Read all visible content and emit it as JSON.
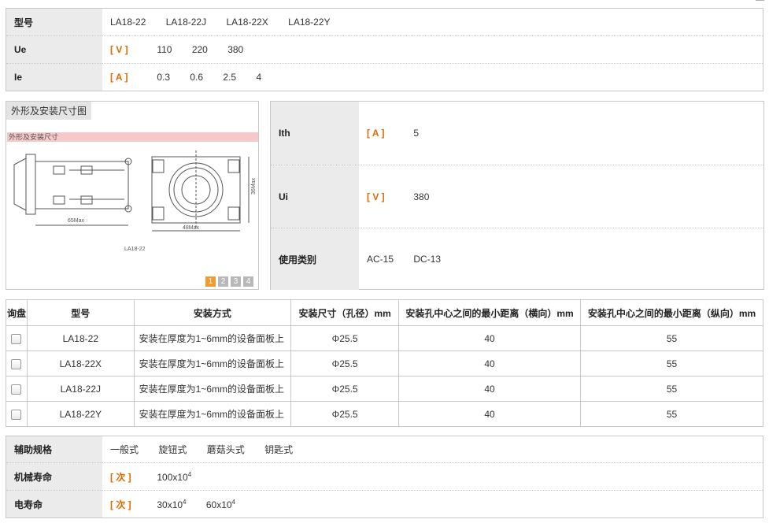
{
  "top_spec": {
    "rows": [
      {
        "label": "型号",
        "unit": "",
        "values": [
          "LA18-22",
          "LA18-22J",
          "LA18-22X",
          "LA18-22Y"
        ]
      },
      {
        "label": "Ue",
        "unit": "[ V ]",
        "values": [
          "110",
          "220",
          "380"
        ]
      },
      {
        "label": "Ie",
        "unit": "[ A ]",
        "values": [
          "0.3",
          "0.6",
          "2.5",
          "4"
        ]
      }
    ]
  },
  "figure": {
    "tab_label": "外形及安装尺寸图",
    "caption": "外形及安装尺寸",
    "dim_65": "65Max",
    "dim_48": "48Max",
    "dim_36": "36Max",
    "model_label": "LA18-22",
    "pages": [
      "1",
      "2",
      "3",
      "4"
    ]
  },
  "right_spec": {
    "rows": [
      {
        "label": "Ith",
        "unit": "[ A ]",
        "values": [
          "5"
        ]
      },
      {
        "label": "Ui",
        "unit": "[ V ]",
        "values": [
          "380"
        ]
      },
      {
        "label": "使用类别",
        "unit": "",
        "values": [
          "AC-15",
          "DC-13"
        ]
      }
    ]
  },
  "order_table": {
    "headers": [
      "询盘",
      "型号",
      "安装方式",
      "安装尺寸（孔径）mm",
      "安装孔中心之间的最小距离（横向）mm",
      "安装孔中心之间的最小距离（纵向）mm"
    ],
    "rows": [
      {
        "model": "LA18-22",
        "mount": "安装在厚度为1~6mm的设备面板上",
        "hole": "Φ25.5",
        "h": "40",
        "v": "55"
      },
      {
        "model": "LA18-22X",
        "mount": "安装在厚度为1~6mm的设备面板上",
        "hole": "Φ25.5",
        "h": "40",
        "v": "55"
      },
      {
        "model": "LA18-22J",
        "mount": "安装在厚度为1~6mm的设备面板上",
        "hole": "Φ25.5",
        "h": "40",
        "v": "55"
      },
      {
        "model": "LA18-22Y",
        "mount": "安装在厚度为1~6mm的设备面板上",
        "hole": "Φ25.5",
        "h": "40",
        "v": "55"
      }
    ]
  },
  "bottom_spec": {
    "aux_label": "辅助规格",
    "aux_values": [
      "一般式",
      "旋钮式",
      "蘑菇头式",
      "钥匙式"
    ],
    "mech_label": "机械寿命",
    "mech_unit": "[ 次 ]",
    "mech_values": [
      {
        "base": "100x10",
        "exp": "4"
      }
    ],
    "elec_label": "电寿命",
    "elec_unit": "[ 次 ]",
    "elec_values": [
      {
        "base": "30x10",
        "exp": "4"
      },
      {
        "base": "60x10",
        "exp": "4"
      }
    ]
  },
  "colors": {
    "accent": "#e06a00",
    "label_bg": "#ebebeb",
    "border": "#c8c8c8",
    "pager_active": "#f29a2e"
  }
}
